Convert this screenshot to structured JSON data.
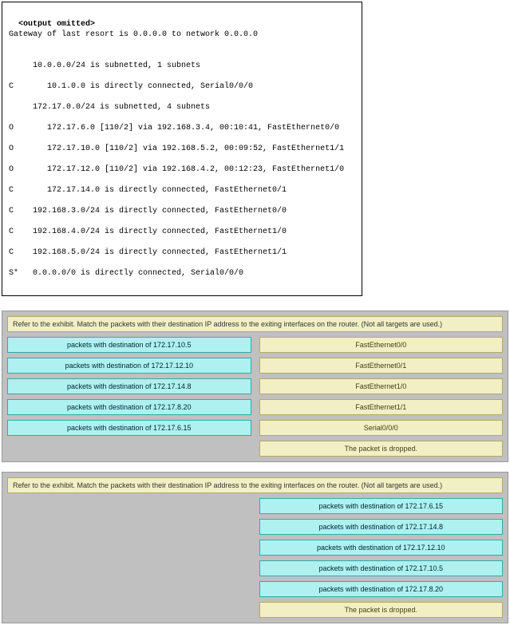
{
  "terminal": {
    "title": "<output omitted>",
    "lines": [
      "Gateway of last resort is 0.0.0.0 to network 0.0.0.0",
      "",
      "     10.0.0.0/24 is subnetted, 1 subnets",
      "C       10.1.0.0 is directly connected, Serial0/0/0",
      "     172.17.0.0/24 is subnetted, 4 subnets",
      "O       172.17.6.0 [110/2] via 192.168.3.4, 00:10:41, FastEthernet0/0",
      "O       172.17.10.0 [110/2] via 192.168.5.2, 00:09:52, FastEthernet1/1",
      "O       172.17.12.0 [110/2] via 192.168.4.2, 00:12:23, FastEthernet1/0",
      "C       172.17.14.0 is directly connected, FastEthernet0/1",
      "C    192.168.3.0/24 is directly connected, FastEthernet0/0",
      "C    192.168.4.0/24 is directly connected, FastEthernet1/0",
      "C    192.168.5.0/24 is directly connected, FastEthernet1/1",
      "S*   0.0.0.0/0 is directly connected, Serial0/0/0"
    ]
  },
  "panel1": {
    "instruction": "Refer to the exhibit. Match the packets with their destination IP address to the exiting interfaces on the router. (Not all targets are used.)",
    "left": [
      "packets with destination of 172.17.10.5",
      "packets with destination of 172.17.12.10",
      "packets with destination of 172.17.14.8",
      "packets with destination of 172.17.8.20",
      "packets with destination of 172.17.6.15"
    ],
    "right": [
      "FastEthernet0/0",
      "FastEthernet0/1",
      "FastEthernet1/0",
      "FastEthernet1/1",
      "Serial0/0/0",
      "The packet is dropped."
    ]
  },
  "panel2": {
    "instruction": "Refer to the exhibit. Match the packets with their destination IP address to the exiting interfaces on the router. (Not all targets are used.)",
    "right": [
      "packets with destination of 172.17.6.15",
      "packets with destination of 172.17.14.8",
      "packets with destination of 172.17.12.10",
      "packets with destination of 172.17.10.5",
      "packets with destination of 172.17.8.20",
      "The packet is dropped."
    ]
  }
}
